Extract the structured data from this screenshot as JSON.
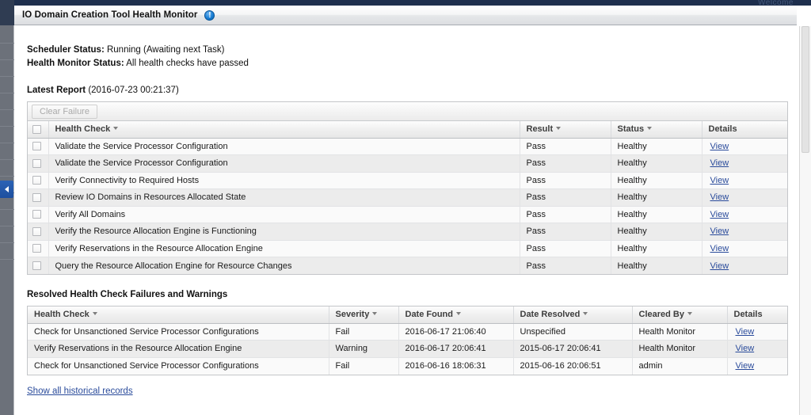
{
  "window": {
    "strip_text": "Welcome",
    "title": "IO Domain Creation Tool Health Monitor",
    "info_icon": "info-icon"
  },
  "sidebar": {
    "collapse_handle": "collapse-panel-arrow"
  },
  "status": {
    "scheduler_label": "Scheduler Status:",
    "scheduler_value": "Running (Awaiting next Task)",
    "monitor_label": "Health Monitor Status:",
    "monitor_value": "All health checks have passed"
  },
  "latest_report": {
    "title": "Latest Report",
    "timestamp": "(2016-07-23 00:21:37)",
    "toolbar": {
      "clear_failure_label": "Clear Failure",
      "clear_failure_enabled": false
    },
    "columns": [
      "Health Check",
      "Result",
      "Status",
      "Details"
    ],
    "rows": [
      {
        "check": "Validate the Service Processor Configuration",
        "result": "Pass",
        "status": "Healthy",
        "details": "View"
      },
      {
        "check": "Validate the Service Processor Configuration",
        "result": "Pass",
        "status": "Healthy",
        "details": "View"
      },
      {
        "check": "Verify Connectivity to Required Hosts",
        "result": "Pass",
        "status": "Healthy",
        "details": "View"
      },
      {
        "check": "Review IO Domains in Resources Allocated State",
        "result": "Pass",
        "status": "Healthy",
        "details": "View"
      },
      {
        "check": "Verify All Domains",
        "result": "Pass",
        "status": "Healthy",
        "details": "View"
      },
      {
        "check": "Verify the Resource Allocation Engine is Functioning",
        "result": "Pass",
        "status": "Healthy",
        "details": "View"
      },
      {
        "check": "Verify Reservations in the Resource Allocation Engine",
        "result": "Pass",
        "status": "Healthy",
        "details": "View"
      },
      {
        "check": "Query the Resource Allocation Engine for Resource Changes",
        "result": "Pass",
        "status": "Healthy",
        "details": "View"
      }
    ]
  },
  "resolved": {
    "title": "Resolved Health Check Failures and Warnings",
    "columns": [
      "Health Check",
      "Severity",
      "Date Found",
      "Date Resolved",
      "Cleared By",
      "Details"
    ],
    "rows": [
      {
        "check": "Check for Unsanctioned Service Processor Configurations",
        "severity": "Fail",
        "date_found": "2016-06-17 21:06:40",
        "date_resolved": "Unspecified",
        "cleared_by": "Health Monitor",
        "details": "View"
      },
      {
        "check": "Verify Reservations in the Resource Allocation Engine",
        "severity": "Warning",
        "date_found": "2016-06-17 20:06:41",
        "date_resolved": "2015-06-17 20:06:41",
        "cleared_by": "Health Monitor",
        "details": "View"
      },
      {
        "check": "Check for Unsanctioned Service Processor Configurations",
        "severity": "Fail",
        "date_found": "2016-06-16 18:06:31",
        "date_resolved": "2015-06-16 20:06:51",
        "cleared_by": "admin",
        "details": "View"
      }
    ]
  },
  "footer": {
    "historical_link": "Show all historical records"
  },
  "colors": {
    "strip": "#1e2f4d",
    "rail": "#6c717a",
    "accent_link": "#2a4b9b",
    "collapse_tab": "#2b62b5"
  }
}
